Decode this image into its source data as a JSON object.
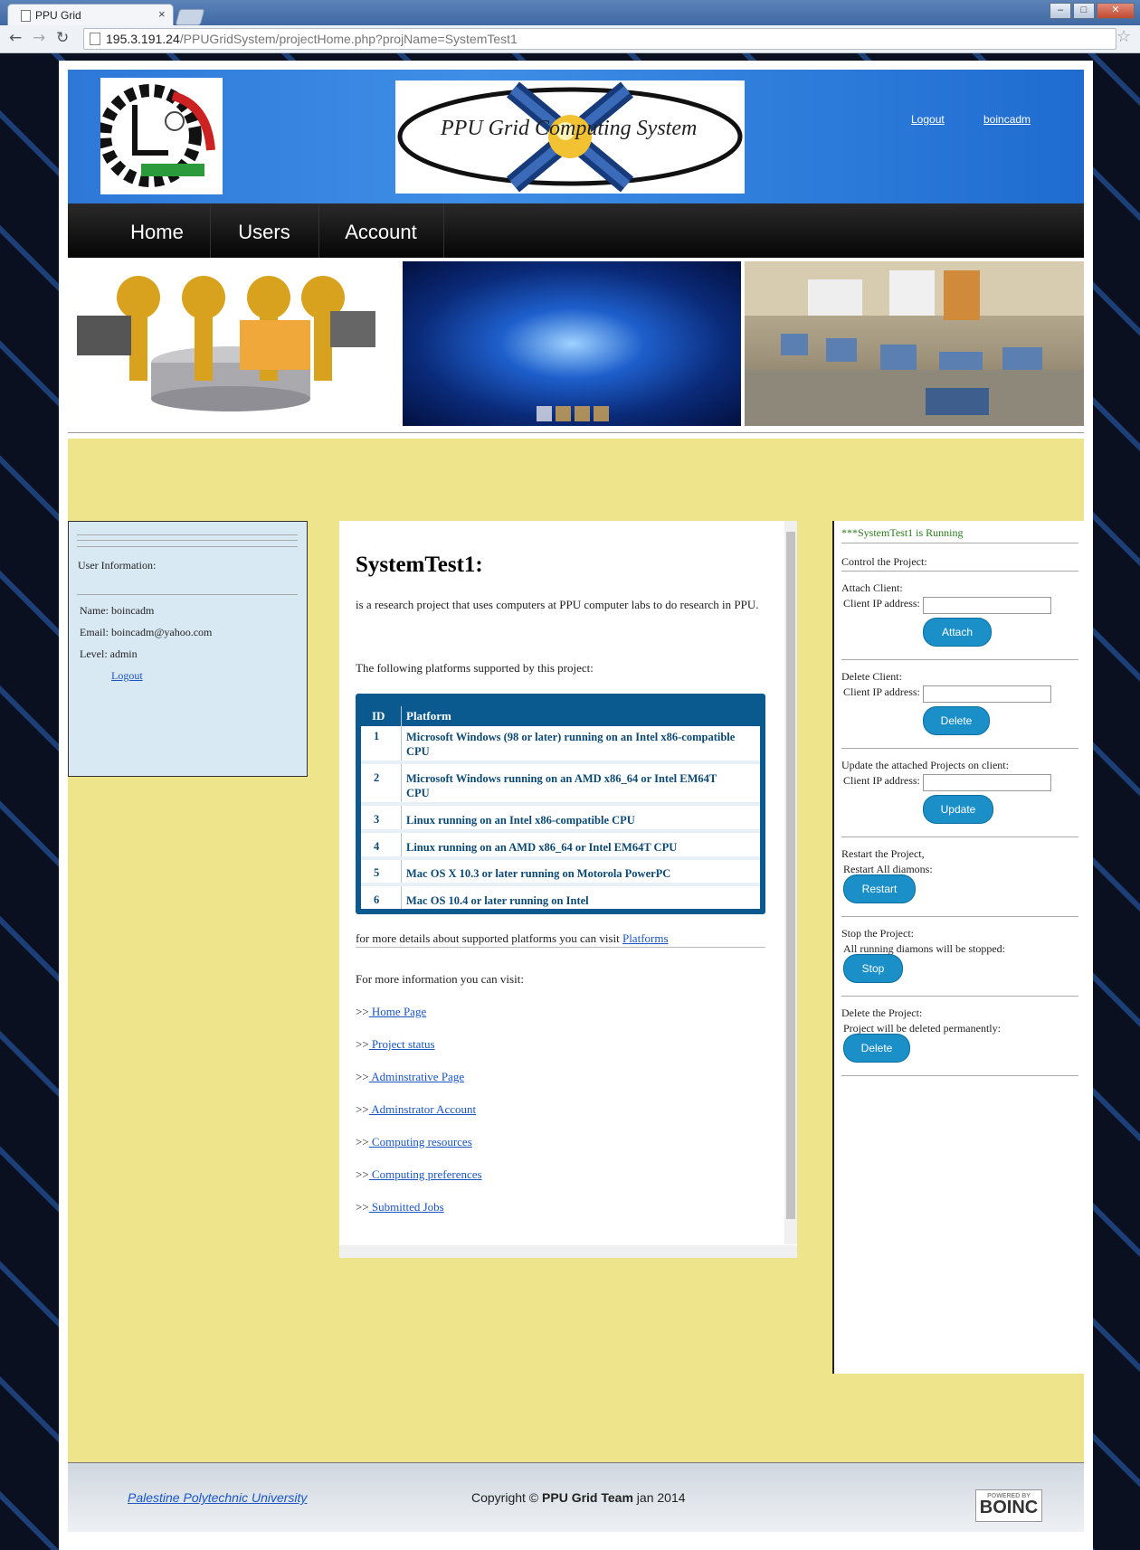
{
  "browser": {
    "tab_title": "PPU Grid",
    "tab_close": "×",
    "url_host": "195.3.191.24",
    "url_path": "/PPUGridSystem/projectHome.php?projName=SystemTest1",
    "icons": [
      "back-icon",
      "forward-icon",
      "reload-icon",
      "page-icon",
      "star-icon"
    ]
  },
  "header": {
    "logo_text": "PPU Grid Computing System",
    "univ_logo_text": "Palestine Polytechnic University",
    "logout": "Logout",
    "username": "boincadm"
  },
  "menu": [
    {
      "label": "Home"
    },
    {
      "label": "Users"
    },
    {
      "label": "Account"
    }
  ],
  "user_info": {
    "title": "User Information:",
    "name": "Name: boincadm",
    "email": "Email: boincadm@yahoo.com",
    "level": "Level:  admin",
    "logout": "Logout"
  },
  "project": {
    "title": "SystemTest1:",
    "desc": "is a research project that uses computers at PPU computer labs to do research in PPU.",
    "platforms_intro": "The following platforms supported by this project:",
    "table_headers": [
      "ID",
      "Platform"
    ],
    "platforms": [
      {
        "id": "1",
        "name": "Microsoft Windows (98 or later) running on an Intel x86-compatible CPU"
      },
      {
        "id": "2",
        "name": "Microsoft Windows running on an AMD x86_64 or Intel EM64T CPU"
      },
      {
        "id": "3",
        "name": "Linux running on an Intel x86-compatible CPU"
      },
      {
        "id": "4",
        "name": "Linux running on an AMD x86_64 or Intel EM64T CPU"
      },
      {
        "id": "5",
        "name": "Mac OS X 10.3 or later running on Motorola PowerPC"
      },
      {
        "id": "6",
        "name": "Mac OS 10.4 or later running on Intel"
      }
    ],
    "more_details": "for more details about supported platforms you can visit",
    "platforms_link": "Platforms",
    "more_info": "For more information you can visit:",
    "prefix": ">>",
    "links": [
      " Home Page ",
      " Project status ",
      " Adminstrative Page ",
      " Adminstrator Account ",
      " Computing resources ",
      " Computing preferences ",
      " Submitted Jobs"
    ]
  },
  "control": {
    "status": "***SystemTest1 is Running",
    "control_title": "Control the Project:",
    "attach_title": "Attach Client:",
    "ip_label": "Client IP address:",
    "attach_btn": "Attach",
    "delete_client_title": "Delete Client:",
    "delete_btn": "Delete",
    "update_title": "Update the attached Projects on client:",
    "update_btn": "Update",
    "restart_title": "Restart the Project,",
    "restart_sub": "Restart All diamons:",
    "restart_btn": "Restart",
    "stop_title": "Stop the Project:",
    "stop_sub": "All running diamons will be stopped:",
    "stop_btn": "Stop",
    "delete_project_title": "Delete the Project:",
    "delete_project_sub": "Project will be deleted permanently:",
    "delete_project_btn": "Delete"
  },
  "footer": {
    "university": "Palestine Polytechnic University",
    "copyright_pre": "Copyright © ",
    "copyright_bold": "PPU Grid Team",
    "copyright_post": " jan 2014",
    "boinc_powered": "POWERED BY",
    "boinc": "BOINC"
  },
  "colors": {
    "header_blue": "#2d78d8",
    "content_yellow": "#eee48c",
    "table_blue": "#0a5a90",
    "button_blue": "#1a8fc8",
    "status_green": "#2a7a1a"
  }
}
